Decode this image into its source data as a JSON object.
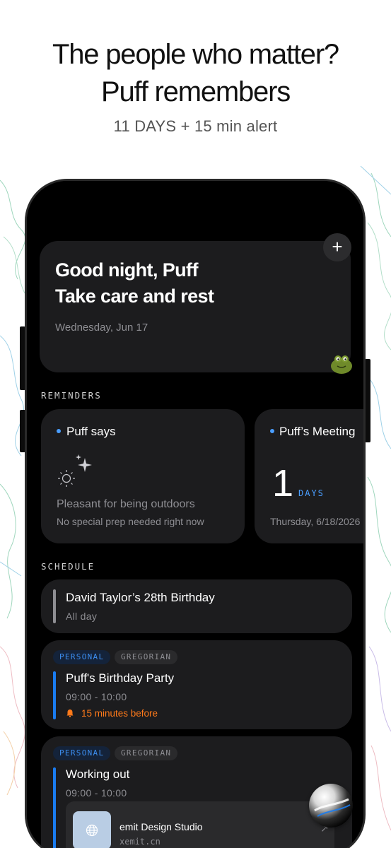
{
  "promo": {
    "title_line1": "The people who matter?",
    "title_line2": "Puff remembers",
    "subtitle": "11 DAYS + 15 min alert"
  },
  "greeting": {
    "line1": "Good night, Puff",
    "line2": "Take care and rest",
    "date": "Wednesday, Jun 17",
    "add_icon": "plus-icon",
    "add_label": "+"
  },
  "reminders": {
    "section_label": "REMINDERS",
    "cards": [
      {
        "title": "Puff says",
        "icon": "sun-sparkle-icon",
        "text": "Pleasant for being outdoors",
        "subtext": "No special prep needed right now"
      },
      {
        "title": "Puff’s Meeting",
        "count": "1",
        "unit": "DAYS",
        "date": "Thursday, 6/18/2026"
      }
    ]
  },
  "schedule": {
    "section_label": "SCHEDULE",
    "events": [
      {
        "title": "David Taylor’s 28th Birthday",
        "time": "All day"
      },
      {
        "tags": [
          "PERSONAL",
          "GREGORIAN"
        ],
        "title": "Puff's Birthday Party",
        "time": "09:00 - 10:00",
        "alert": "15 minutes before"
      },
      {
        "tags": [
          "PERSONAL",
          "GREGORIAN"
        ],
        "title": "Working out",
        "time": "09:00 - 10:00",
        "link": {
          "title": "emit Design Studio",
          "url": "xemit.cn",
          "arrow": "↗"
        }
      }
    ]
  },
  "colors": {
    "accent_blue": "#1a7cf0",
    "alert_orange": "#ff7a1a",
    "card_bg": "#1c1c1e"
  }
}
